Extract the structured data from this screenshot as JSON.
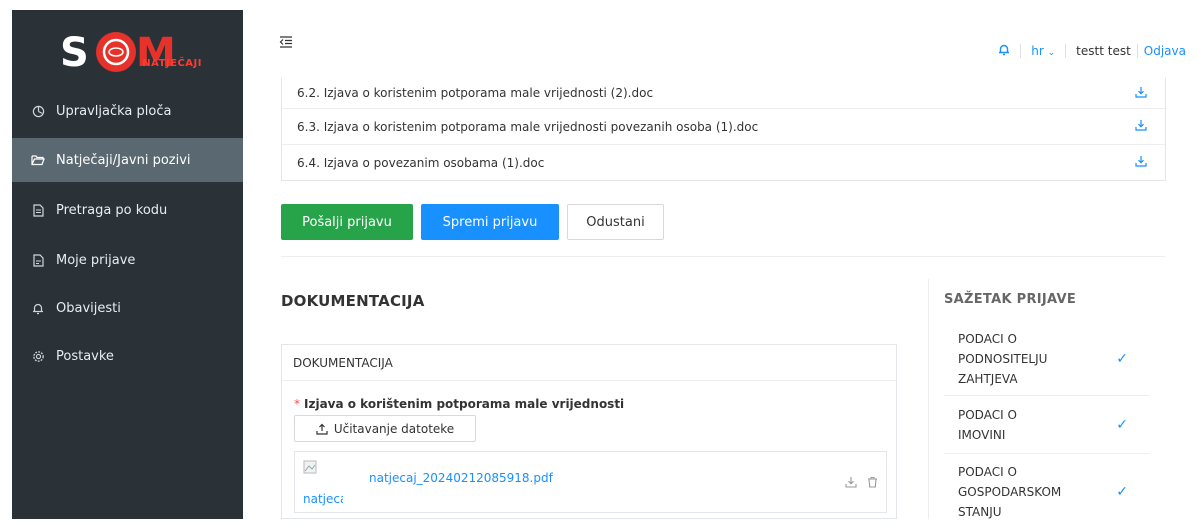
{
  "app": {
    "logo_text": "SOM",
    "logo_badge": "NATJEČAJI"
  },
  "sidebar": {
    "items": [
      {
        "label": "Upravljačka ploča",
        "icon": "dashboard-icon"
      },
      {
        "label": "Natječaji/Javni pozivi",
        "icon": "folder-open-icon"
      },
      {
        "label": "Pretraga po kodu",
        "icon": "file-icon"
      },
      {
        "label": "Moje prijave",
        "icon": "file-text-icon"
      },
      {
        "label": "Obavijesti",
        "icon": "bell-icon"
      },
      {
        "label": "Postavke",
        "icon": "gear-icon"
      }
    ]
  },
  "header": {
    "language": "hr",
    "user_name": "testt test",
    "logout_label": "Odjava"
  },
  "files": [
    {
      "name": "6.2. Izjava o koristenim potporama male vrijednosti (2).doc"
    },
    {
      "name": "6.3. Izjava o koristenim potporama male vrijednosti povezanih osoba (1).doc"
    },
    {
      "name": "6.4. Izjava o povezanim osobama (1).doc"
    }
  ],
  "actions": {
    "send_label": "Pošalji prijavu",
    "save_label": "Spremi prijavu",
    "cancel_label": "Odustani"
  },
  "documentation": {
    "section_title": "DOKUMENTACIJA",
    "panel_title": "DOKUMENTACIJA",
    "required_field_label": "Izjava o korištenim potporama male vrijednosti",
    "upload_label": "Učitavanje datoteke",
    "uploaded_file_name": "natjecaj_20240212085918.pdf",
    "uploaded_file_alt": "natjecaj_20240212085918.pdf"
  },
  "summary": {
    "title": "SAŽETAK PRIJAVE",
    "items": [
      {
        "label": "PODACI O PODNOSITELJU ZAHTJEVA",
        "status": "done"
      },
      {
        "label": "PODACI O IMOVINI",
        "status": "done"
      },
      {
        "label": "PODACI O GOSPODARSKOM STANJU",
        "status": "done"
      }
    ]
  },
  "colors": {
    "sidebar_bg": "#2a3238",
    "sidebar_active": "#5a6872",
    "primary": "#1890ff",
    "success": "#27a34a",
    "brand_red": "#ff3b30"
  }
}
